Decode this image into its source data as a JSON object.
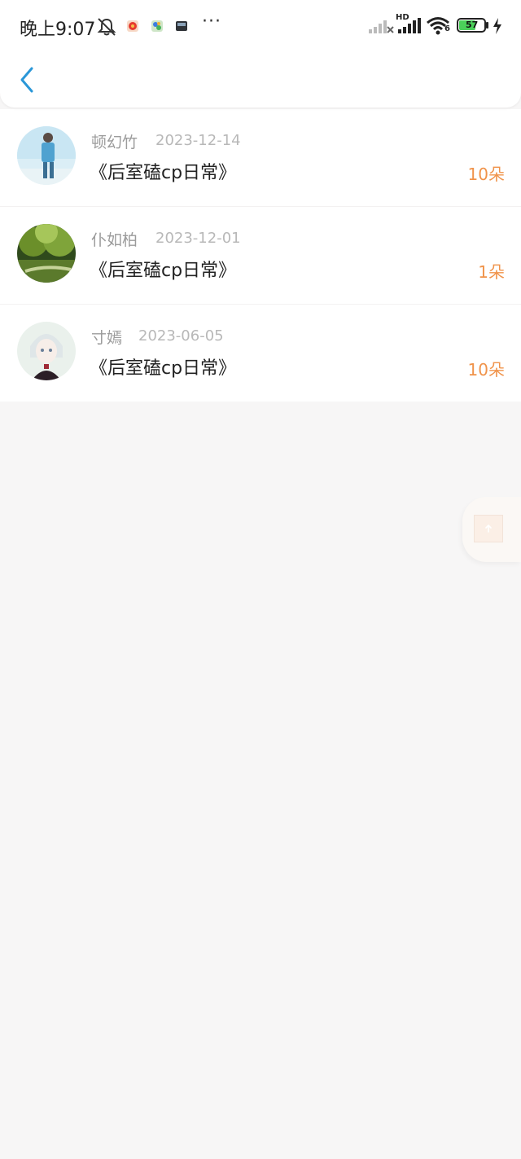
{
  "status_bar": {
    "time": "晚上9:07",
    "more": "···",
    "network_badge": "HD",
    "wifi_badge": "6",
    "battery": "57"
  },
  "header": {
    "back_icon": "chevron-left-icon",
    "accent": "#2a97d8"
  },
  "gifts": [
    {
      "name": "顿幻竹",
      "date": "2023-12-14",
      "book": "《后室磕cp日常》",
      "count": "10朵",
      "avatar": "avatar-sky"
    },
    {
      "name": "仆如柏",
      "date": "2023-12-01",
      "book": "《后室磕cp日常》",
      "count": "1朵",
      "avatar": "avatar-forest"
    },
    {
      "name": "寸嫣",
      "date": "2023-06-05",
      "book": "《后室磕cp日常》",
      "count": "10朵",
      "avatar": "avatar-anime"
    }
  ],
  "colors": {
    "count": "#f0934a",
    "name": "#9b9b9b",
    "date": "#b8b8b8",
    "background": "#f7f6f6"
  },
  "float_button": {
    "icon": "arrow-up-icon"
  }
}
